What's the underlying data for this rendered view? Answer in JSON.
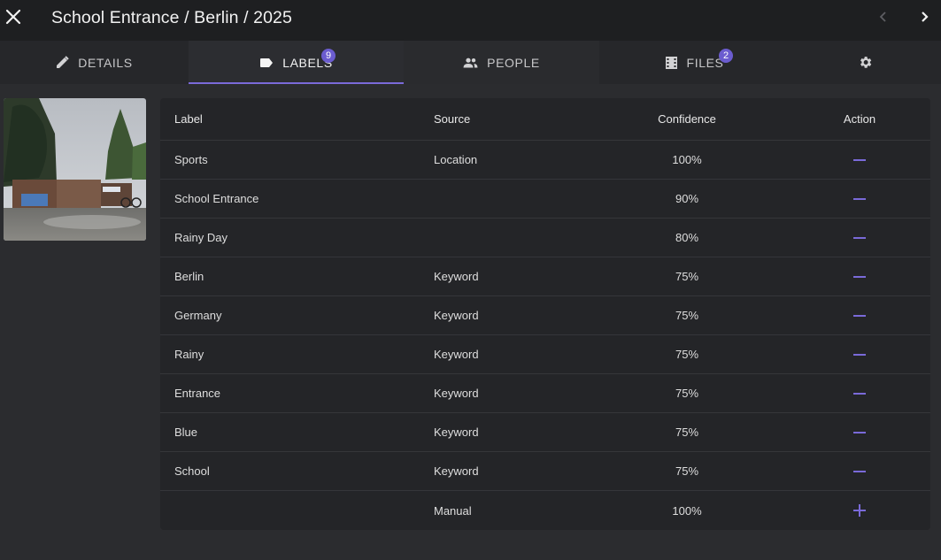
{
  "header": {
    "title": "School Entrance / Berlin / 2025",
    "close_icon": "close-icon",
    "prev_icon": "chevron-left-icon",
    "next_icon": "chevron-right-icon"
  },
  "tabs": [
    {
      "label": "DETAILS",
      "icon": "pencil-icon",
      "active": false
    },
    {
      "label": "LABELS",
      "icon": "label-icon",
      "badge": "9",
      "active": true
    },
    {
      "label": "PEOPLE",
      "icon": "people-icon",
      "active": false
    },
    {
      "label": "FILES",
      "icon": "film-icon",
      "badge": "2",
      "active": false
    },
    {
      "label": "",
      "icon": "gear-icon",
      "active": false
    }
  ],
  "table": {
    "headers": {
      "label": "Label",
      "source": "Source",
      "confidence": "Confidence",
      "action": "Action"
    },
    "rows": [
      {
        "label": "Sports",
        "source": "Location",
        "confidence": "100%",
        "action": "remove"
      },
      {
        "label": "School Entrance",
        "source": "",
        "confidence": "90%",
        "action": "remove"
      },
      {
        "label": "Rainy Day",
        "source": "",
        "confidence": "80%",
        "action": "remove"
      },
      {
        "label": "Berlin",
        "source": "Keyword",
        "confidence": "75%",
        "action": "remove"
      },
      {
        "label": "Germany",
        "source": "Keyword",
        "confidence": "75%",
        "action": "remove"
      },
      {
        "label": "Rainy",
        "source": "Keyword",
        "confidence": "75%",
        "action": "remove"
      },
      {
        "label": "Entrance",
        "source": "Keyword",
        "confidence": "75%",
        "action": "remove"
      },
      {
        "label": "Blue",
        "source": "Keyword",
        "confidence": "75%",
        "action": "remove"
      },
      {
        "label": "School",
        "source": "Keyword",
        "confidence": "75%",
        "action": "remove"
      },
      {
        "label": "",
        "source": "Manual",
        "confidence": "100%",
        "action": "add"
      }
    ]
  },
  "colors": {
    "accent": "#7a6ad9",
    "badge": "#6b5ccf",
    "background": "#2b2c2f",
    "card": "#242528"
  }
}
